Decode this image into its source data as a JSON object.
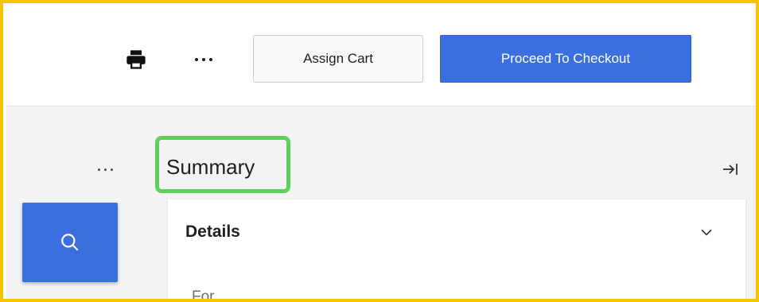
{
  "toolbar": {
    "print_icon": "printer-icon",
    "more_icon": "more-horizontal-icon",
    "assign_cart_label": "Assign Cart",
    "checkout_label": "Proceed To Checkout"
  },
  "panel": {
    "more_icon": "more-horizontal-icon",
    "title": "Summary",
    "collapse_icon": "collapse-right-icon",
    "search_icon": "search-icon"
  },
  "details": {
    "title": "Details",
    "chevron_icon": "chevron-down-icon",
    "for_label": "For"
  },
  "colors": {
    "primary": "#3b6fe0",
    "highlight": "#5fd15a",
    "frame": "#f6c500"
  }
}
